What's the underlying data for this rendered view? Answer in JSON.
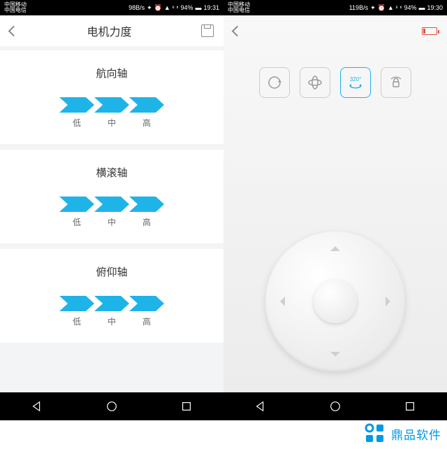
{
  "statusLeft": {
    "carrier1": "中国移动",
    "carrier2": "中国电信",
    "speed": "98B/s",
    "battery": "94%",
    "time": "19:31"
  },
  "statusRight": {
    "carrier1": "中国移动",
    "carrier2": "中国电信",
    "speed": "119B/s",
    "battery": "94%",
    "time": "19:30"
  },
  "leftScreen": {
    "title": "电机力度",
    "sections": [
      {
        "title": "航向轴",
        "levels": [
          "低",
          "中",
          "高"
        ]
      },
      {
        "title": "横滚轴",
        "levels": [
          "低",
          "中",
          "高"
        ]
      },
      {
        "title": "俯仰轴",
        "levels": [
          "低",
          "中",
          "高"
        ]
      }
    ]
  },
  "rightScreen": {
    "modes": [
      "rotate",
      "spin-3d",
      "320°",
      "lock"
    ],
    "activeModeIndex": 2,
    "activeModeLabel": "320°"
  },
  "watermark": {
    "text": "鼎品软件"
  }
}
